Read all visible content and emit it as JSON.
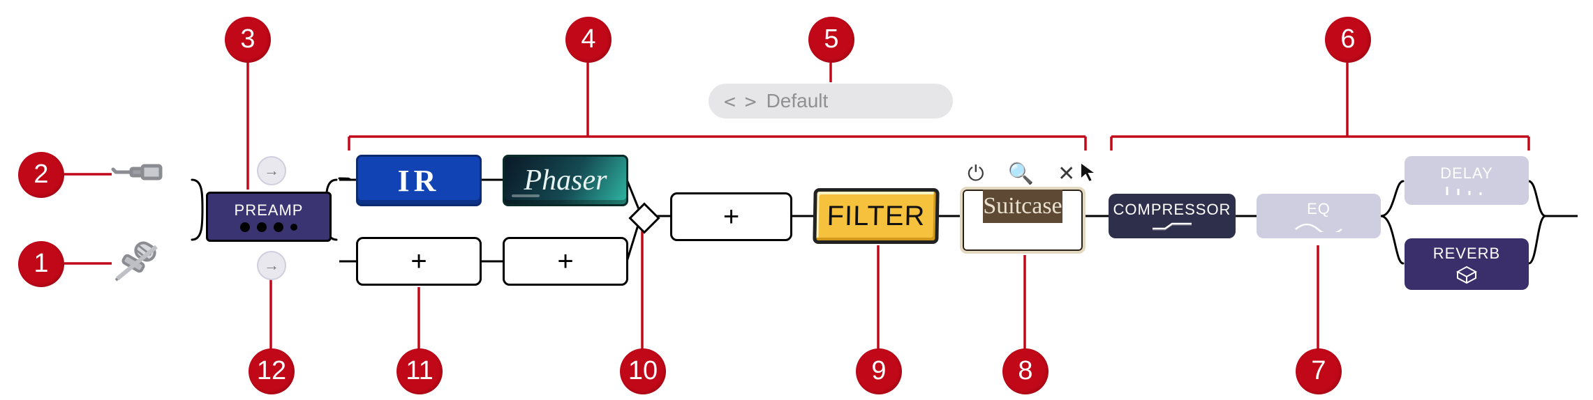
{
  "chart_data": {
    "type": "diagram",
    "description": "Audio effects signal-chain editor with numbered callouts 1–12.",
    "callouts": [
      {
        "n": 1,
        "target": "input-mic-icon",
        "role": "Microphone / pickup input"
      },
      {
        "n": 2,
        "target": "input-jack-icon",
        "role": "Instrument jack input"
      },
      {
        "n": 3,
        "target": "preamp-block",
        "role": "Preamp module"
      },
      {
        "n": 4,
        "target": "pre-effects-rack",
        "role": "Pre-amp effects section (two parallel lanes)"
      },
      {
        "n": 5,
        "target": "preset-selector",
        "role": "Preset name / selector"
      },
      {
        "n": 6,
        "target": "post-effects-rack",
        "role": "Post effects section (with parallel Delay / Reverb)"
      },
      {
        "n": 7,
        "target": "eq-block",
        "role": "EQ module (disabled / ghosted)"
      },
      {
        "n": 8,
        "target": "suitcase-block",
        "role": "Amp / cabinet module (hover tools shown)"
      },
      {
        "n": 9,
        "target": "filter-block",
        "role": "Filter pedal"
      },
      {
        "n": 10,
        "target": "merge-node",
        "role": "Lane merge / swap node"
      },
      {
        "n": 11,
        "target": "empty-slot",
        "role": "Empty effect slot (add)"
      },
      {
        "n": 12,
        "target": "route-arrow",
        "role": "Lane routing button"
      }
    ],
    "chain_layout": {
      "inputs": [
        "input-jack-icon",
        "input-mic-icon"
      ],
      "preamp": "preamp-block",
      "pre_section": {
        "top_lane": [
          "ir-block",
          "phaser-block"
        ],
        "bottom_lane": [
          "empty-slot",
          "empty-slot"
        ],
        "merge": "merge-node",
        "serial_after_merge": [
          "empty-slot",
          "filter-block",
          "suitcase-block"
        ]
      },
      "post_section": {
        "serial": [
          "compressor-block",
          "eq-block"
        ],
        "parallel": [
          "delay-block",
          "reverb-block"
        ]
      }
    }
  },
  "preset": {
    "nav_glyphs": "< >",
    "name": "Default"
  },
  "inputs": {
    "jack_icon_name": "jack-plug",
    "mic_icon_name": "microphone"
  },
  "preamp": {
    "label": "PREAMP"
  },
  "routes": {
    "top_glyph": "→",
    "bottom_glyph": "→"
  },
  "pre_rack": {
    "ir": {
      "label": "IR"
    },
    "phaser": {
      "label": "Phaser"
    },
    "add_glyph": "+"
  },
  "amp_section": {
    "filter": {
      "label": "FILTER"
    },
    "suitcase": {
      "label": "Suitcase"
    },
    "hover": {
      "power_glyph": "⏻",
      "zoom_glyph": "🔍",
      "close_glyph": "✕"
    }
  },
  "post_rack": {
    "compressor": {
      "label": "COMPRESSOR"
    },
    "eq": {
      "label": "EQ"
    },
    "delay": {
      "label": "DELAY"
    },
    "reverb": {
      "label": "REVERB"
    }
  },
  "callouts": {
    "1": "1",
    "2": "2",
    "3": "3",
    "4": "4",
    "5": "5",
    "6": "6",
    "7": "7",
    "8": "8",
    "9": "9",
    "10": "10",
    "11": "11",
    "12": "12"
  }
}
